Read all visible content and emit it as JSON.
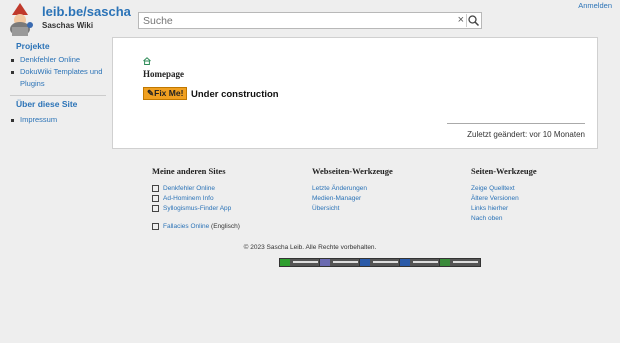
{
  "header": {
    "site_title": "leib.be/sascha",
    "tagline": "Saschas Wiki",
    "login_label": "Anmelden",
    "search_placeholder": "Suche"
  },
  "sidebar": {
    "sections": [
      {
        "title": "Projekte",
        "items": [
          "Denkfehler Online",
          "DokuWiki Templates und Plugins"
        ]
      },
      {
        "title": "Über diese Site",
        "items": [
          "Impressum"
        ]
      }
    ]
  },
  "content": {
    "heading": "Homepage",
    "fixme_label": "Fix Me!",
    "status_text": "Under construction",
    "last_modified": "Zuletzt geändert: vor 10 Monaten"
  },
  "footer": {
    "columns": [
      {
        "title": "Meine anderen Sites",
        "items": [
          {
            "icon": "book-icon",
            "label": "Denkfehler Online",
            "suffix": ""
          },
          {
            "icon": "ad-hominem-icon",
            "label": "Ad-Hominem Info",
            "suffix": ""
          },
          {
            "icon": "finder-icon",
            "label": "Syllogismus-Finder App",
            "suffix": ""
          },
          {
            "icon": "book-icon",
            "label": "Fallacies Online",
            "suffix": " (Englisch)"
          }
        ]
      },
      {
        "title": "Webseiten-Werkzeuge",
        "items": [
          {
            "label": "Letzte Änderungen"
          },
          {
            "label": "Medien-Manager"
          },
          {
            "label": "Übersicht"
          }
        ]
      },
      {
        "title": "Seiten-Werkzeuge",
        "items": [
          {
            "label": "Zeige Quelltext"
          },
          {
            "label": "Ältere Versionen"
          },
          {
            "label": "Links hierher"
          },
          {
            "label": "Nach oben"
          }
        ]
      }
    ],
    "copyright": "© 2023 Sascha Leib. Alle Rechte vorbehalten.",
    "badges": [
      {
        "icon": "cc-badge-icon",
        "accent": "#2e9e2e"
      },
      {
        "icon": "php-badge-icon",
        "accent": "#6a6ab0"
      },
      {
        "icon": "w3c-html-badge-icon",
        "accent": "#2a5aa8"
      },
      {
        "icon": "w3c-css-badge-icon",
        "accent": "#2a5aa8"
      },
      {
        "icon": "dokuwiki-badge-icon",
        "accent": "#3a8a3a"
      }
    ]
  }
}
